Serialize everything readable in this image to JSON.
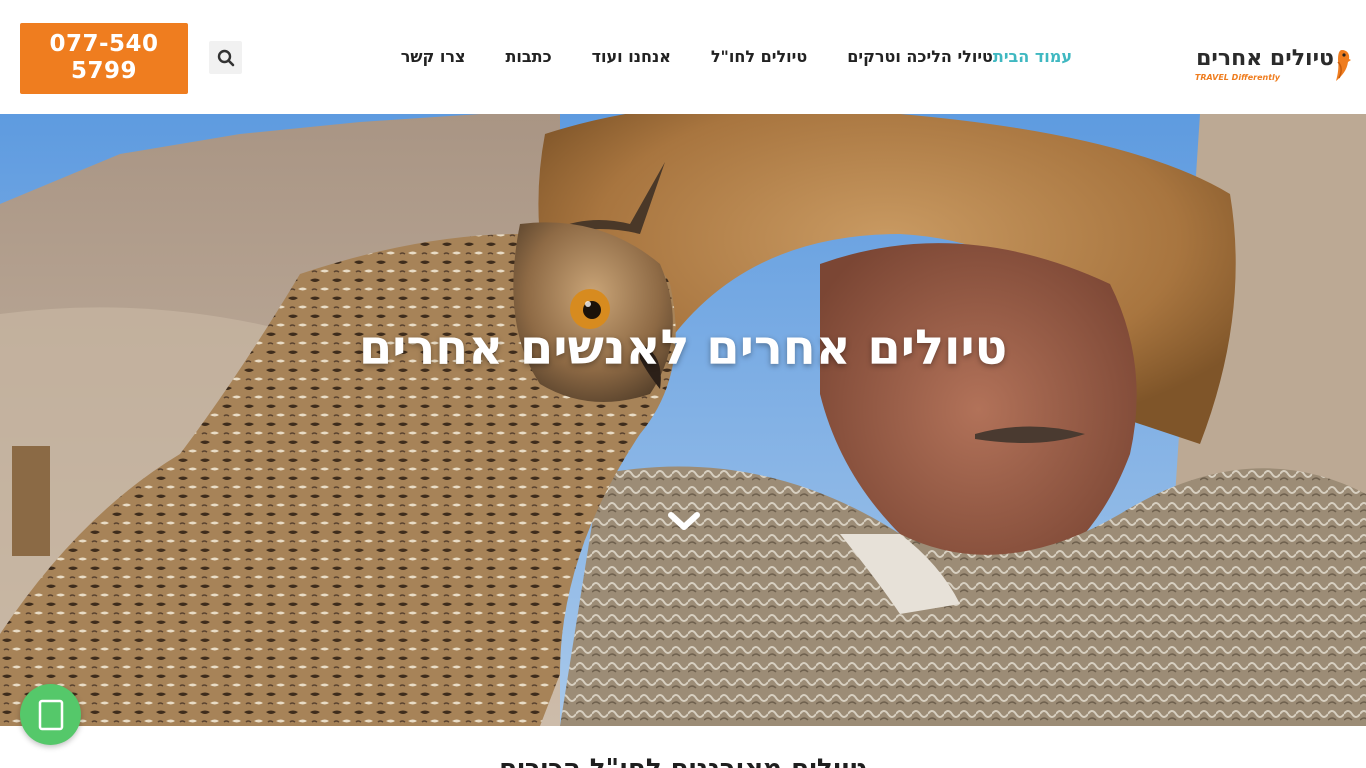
{
  "header": {
    "phone": "077-5405799",
    "logo": {
      "name": "טיולים אחרים",
      "tagline": "TRAVEL Differently"
    },
    "nav": [
      {
        "label": "עמוד הבית",
        "active": true
      },
      {
        "label": "טיולי הליכה וטרקים",
        "active": false
      },
      {
        "label": "טיולים לחו\"ל",
        "active": false
      },
      {
        "label": "אנחנו ועוד",
        "active": false
      },
      {
        "label": "כתבות",
        "active": false
      },
      {
        "label": "צרו קשר",
        "active": false
      }
    ],
    "icons": {
      "search": "search-icon",
      "logo_bird": "bird-icon"
    }
  },
  "hero": {
    "title": "טיולים אחרים לאנשים אחרים",
    "scroll_icon": "chevron-down-icon"
  },
  "chat": {
    "icon": "chat-icon",
    "color": "#55c86a"
  },
  "section": {
    "title": "טיולים מאורגנים לחו\"ל הכירים"
  },
  "colors": {
    "accent_orange": "#ef7d1f",
    "active_nav": "#3fb8c1"
  }
}
